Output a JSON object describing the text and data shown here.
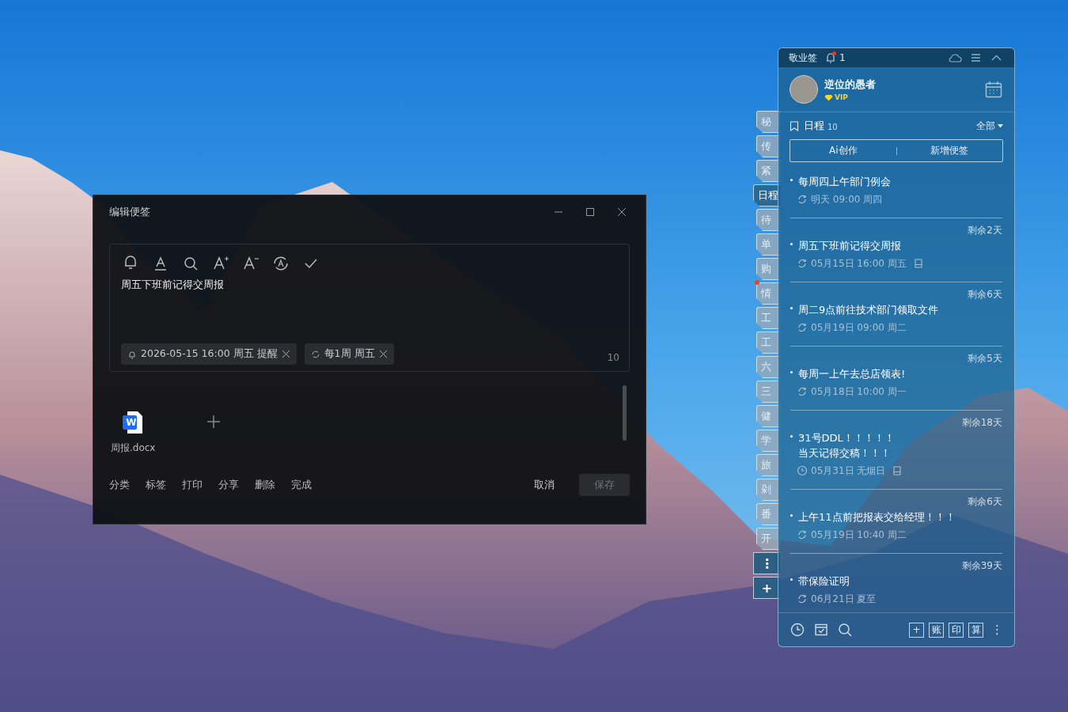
{
  "editor": {
    "title": "编辑便签",
    "text": "周五下班前记得交周报",
    "chips": [
      {
        "kind": "reminder",
        "label": "2026-05-15 16:00 周五 提醒"
      },
      {
        "kind": "repeat",
        "label": "每1周 周五"
      }
    ],
    "char_count": "10",
    "attachments": [
      {
        "name": "周报.docx",
        "icon_letter": "W"
      }
    ],
    "actions": [
      "分类",
      "标签",
      "打印",
      "分享",
      "删除",
      "完成"
    ],
    "cancel": "取消",
    "save": {
      "label": "保存",
      "disabled": true
    }
  },
  "side_tabs": {
    "tabs": [
      {
        "label": "秘",
        "selected": false,
        "unread": false
      },
      {
        "label": "传",
        "selected": false,
        "unread": false
      },
      {
        "label": "紧",
        "selected": false,
        "unread": false
      },
      {
        "label": "日程",
        "selected": true,
        "unread": false
      },
      {
        "label": "待",
        "selected": false,
        "unread": false
      },
      {
        "label": "单",
        "selected": false,
        "unread": false
      },
      {
        "label": "购",
        "selected": false,
        "unread": false
      },
      {
        "label": "情",
        "selected": false,
        "unread": true
      },
      {
        "label": "工",
        "selected": false,
        "unread": false
      },
      {
        "label": "工",
        "selected": false,
        "unread": false
      },
      {
        "label": "六",
        "selected": false,
        "unread": false
      },
      {
        "label": "三",
        "selected": false,
        "unread": false
      },
      {
        "label": "健",
        "selected": false,
        "unread": false
      },
      {
        "label": "学",
        "selected": false,
        "unread": false
      },
      {
        "label": "旅",
        "selected": false,
        "unread": false
      },
      {
        "label": "剁",
        "selected": false,
        "unread": false
      },
      {
        "label": "番",
        "selected": false,
        "unread": false
      },
      {
        "label": "开",
        "selected": false,
        "unread": false
      }
    ],
    "more": "⋮",
    "add": "+"
  },
  "panel": {
    "app_name": "敬业签",
    "notification_count": "1",
    "has_unread": true,
    "user": {
      "name": "逆位的愚者",
      "badge": "VIP"
    },
    "section": {
      "title": "日程",
      "count": "10",
      "filter": "全部"
    },
    "buttons": [
      "Ai创作",
      "新增便签"
    ],
    "items": [
      {
        "lines": [
          "每周四上午部门例会"
        ],
        "kind": "repeat",
        "time": "明天 09:00 周四",
        "attachment": false
      },
      {
        "remaining": "剩余2天",
        "lines": [
          "周五下班前记得交周报"
        ],
        "kind": "repeat",
        "time": "05月15日 16:00 周五",
        "attachment": true
      },
      {
        "remaining": "剩余6天",
        "lines": [
          "周二9点前往技术部门领取文件"
        ],
        "kind": "repeat",
        "time": "05月19日 09:00 周二",
        "attachment": false
      },
      {
        "remaining": "剩余5天",
        "lines": [
          "每周一上午去总店领表!"
        ],
        "kind": "repeat",
        "time": "05月18日 10:00 周一",
        "attachment": false
      },
      {
        "remaining": "剩余18天",
        "lines": [
          "31号DDL！！！！！",
          "当天记得交稿！！！"
        ],
        "kind": "clock",
        "time": "05月31日 无烟日",
        "attachment": true
      },
      {
        "remaining": "剩余6天",
        "lines": [
          "上午11点前把报表交给经理！！！"
        ],
        "kind": "repeat",
        "time": "05月19日 10:40 周二",
        "attachment": false
      },
      {
        "remaining": "剩余39天",
        "lines": [
          "带保险证明"
        ],
        "kind": "repeat",
        "time": "06月21日 夏至",
        "attachment": false
      }
    ],
    "footer_tools": [
      "+",
      "账",
      "印",
      "算"
    ],
    "footer_more": "⋮"
  }
}
